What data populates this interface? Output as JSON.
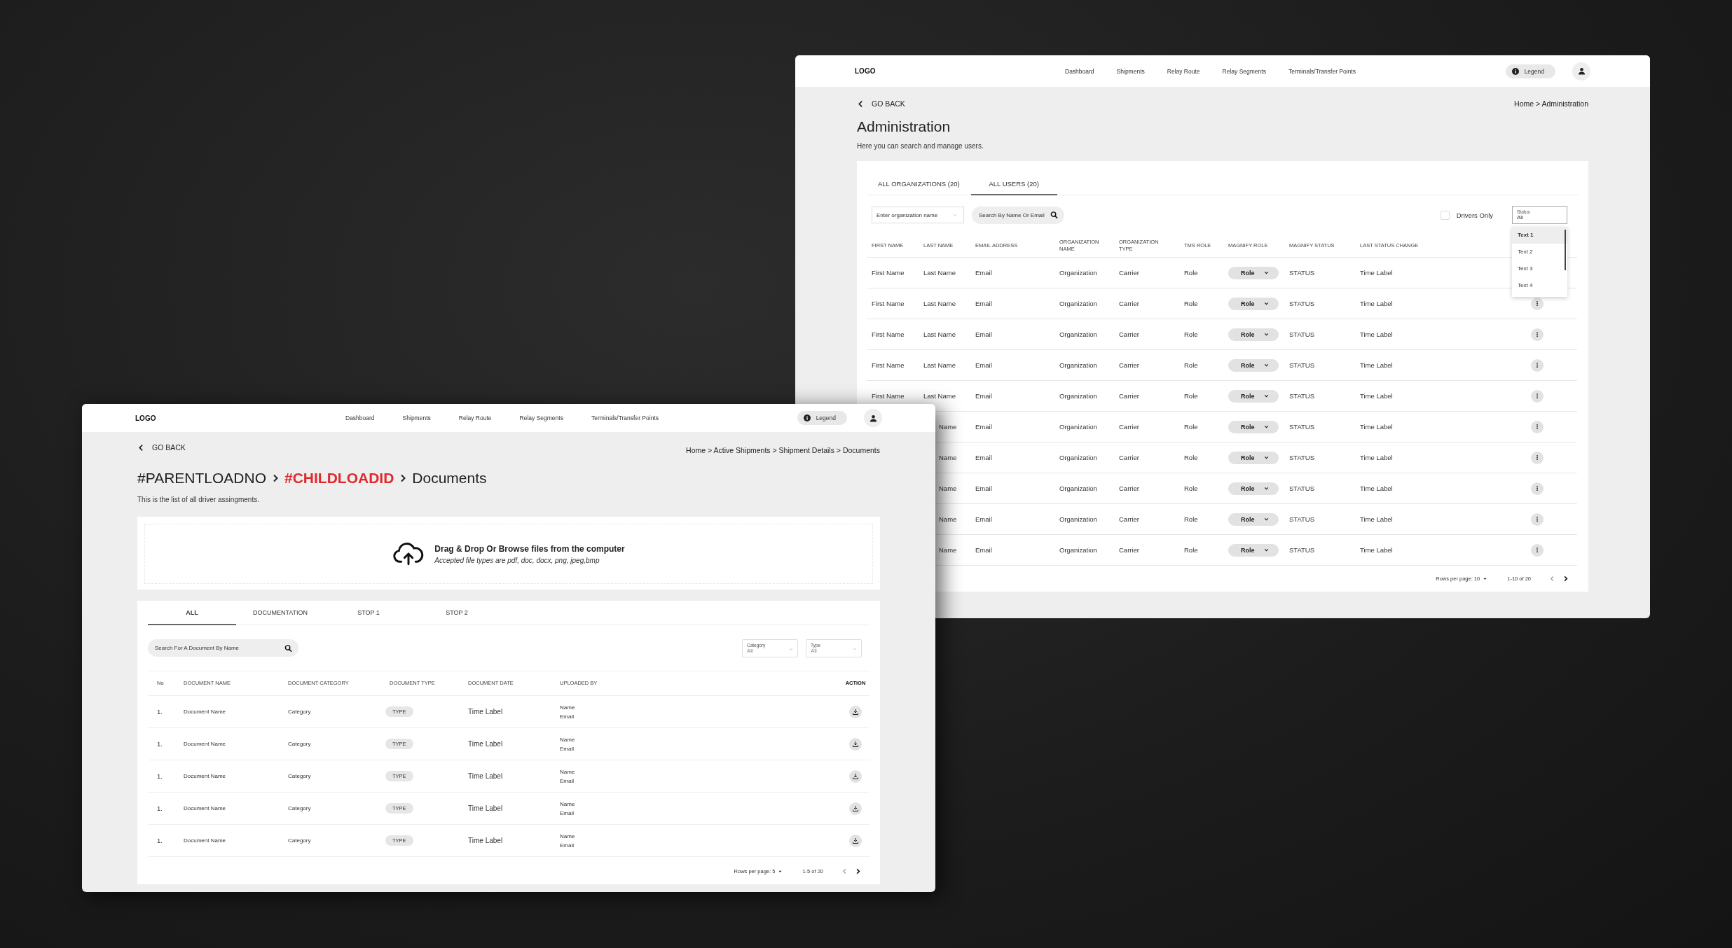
{
  "admin_window": {
    "nav": {
      "logo": "LOGO",
      "items": [
        "Dashboard",
        "Shipments",
        "Relay Route",
        "Relay Segments",
        "Terminals/Transfer Points"
      ],
      "legend": "Legend"
    },
    "go_back": "GO BACK",
    "breadcrumb": "Home > Administration",
    "title": "Administration",
    "subtitle": "Here you can search and manage users.",
    "tabs": [
      {
        "label": "ALL ORGANIZATIONS (20)",
        "selected": false
      },
      {
        "label": "ALL USERS (20)",
        "selected": true
      }
    ],
    "organization_field": {
      "placeholder": "Enter organization name"
    },
    "search": {
      "placeholder": "Search By Name Or Email"
    },
    "drivers_only": {
      "label": "Drivers Only",
      "checked": false
    },
    "status_select": {
      "label": "Status",
      "value": "All",
      "expanded": true,
      "options": [
        {
          "label": "Text 1",
          "selected": true
        },
        {
          "label": "Text 2",
          "selected": false
        },
        {
          "label": "Text 3",
          "selected": false
        },
        {
          "label": "Text 4",
          "selected": false
        }
      ]
    },
    "table": {
      "columns": [
        "FIRST NAME",
        "LAST NAME",
        "EMAIL ADDRESS",
        "ORGANIZATION NAME",
        "ORGANIZATION TYPE",
        "TMS ROLE",
        "MAGNIFY ROLE",
        "MAGNIFY STATUS",
        "LAST STATUS CHANGE"
      ],
      "rows": [
        {
          "first_name": "First Name",
          "last_name": "Last Name",
          "email": "Email",
          "organization": "Organization",
          "organization_type": "Carrier",
          "tms_role": "Role",
          "magnify_role": "Role",
          "magnify_status": "STATUS",
          "last_status_change": "Time Label"
        },
        {
          "first_name": "First Name",
          "last_name": "Last Name",
          "email": "Email",
          "organization": "Organization",
          "organization_type": "Carrier",
          "tms_role": "Role",
          "magnify_role": "Role",
          "magnify_status": "STATUS",
          "last_status_change": "Time Label"
        },
        {
          "first_name": "First Name",
          "last_name": "Last Name",
          "email": "Email",
          "organization": "Organization",
          "organization_type": "Carrier",
          "tms_role": "Role",
          "magnify_role": "Role",
          "magnify_status": "STATUS",
          "last_status_change": "Time Label"
        },
        {
          "first_name": "First Name",
          "last_name": "Last Name",
          "email": "Email",
          "organization": "Organization",
          "organization_type": "Carrier",
          "tms_role": "Role",
          "magnify_role": "Role",
          "magnify_status": "STATUS",
          "last_status_change": "Time Label"
        },
        {
          "first_name": "First Name",
          "last_name": "Last Name",
          "email": "Email",
          "organization": "Organization",
          "organization_type": "Carrier",
          "tms_role": "Role",
          "magnify_role": "Role",
          "magnify_status": "STATUS",
          "last_status_change": "Time Label"
        },
        {
          "last_name": "Name",
          "email": "Email",
          "organization": "Organization",
          "organization_type": "Carrier",
          "tms_role": "Role",
          "magnify_role": "Role",
          "magnify_status": "STATUS",
          "last_status_change": "Time Label"
        },
        {
          "last_name": "Name",
          "email": "Email",
          "organization": "Organization",
          "organization_type": "Carrier",
          "tms_role": "Role",
          "magnify_role": "Role",
          "magnify_status": "STATUS",
          "last_status_change": "Time Label"
        },
        {
          "last_name": "Name",
          "email": "Email",
          "organization": "Organization",
          "organization_type": "Carrier",
          "tms_role": "Role",
          "magnify_role": "Role",
          "magnify_status": "STATUS",
          "last_status_change": "Time Label"
        },
        {
          "last_name": "Name",
          "email": "Email",
          "organization": "Organization",
          "organization_type": "Carrier",
          "tms_role": "Role",
          "magnify_role": "Role",
          "magnify_status": "STATUS",
          "last_status_change": "Time Label"
        },
        {
          "last_name": "Name",
          "email": "Email",
          "organization": "Organization",
          "organization_type": "Carrier",
          "tms_role": "Role",
          "magnify_role": "Role",
          "magnify_status": "STATUS",
          "last_status_change": "Time Label"
        }
      ]
    },
    "pagination": {
      "rows_per_page": "Rows per page: 10",
      "range": "1-10 of 20",
      "previous_disabled": true
    }
  },
  "documents_window": {
    "nav": {
      "logo": "LOGO",
      "items": [
        "Dashboard",
        "Shipments",
        "Relay Route",
        "Relay Segments",
        "Terminals/Transfer Points"
      ],
      "legend": "Legend"
    },
    "go_back": "GO BACK",
    "breadcrumb": "Home > Active Shipments > Shipment Details > Documents",
    "title_parts": [
      {
        "text": "#PARENTLOADNO",
        "highlight": false
      },
      {
        "text": "#CHILDLOADID",
        "highlight": true
      },
      {
        "text": "Documents",
        "highlight": false
      }
    ],
    "subtitle": "This is the list of all driver assingments.",
    "upload": {
      "title": "Drag & Drop Or Browse files from the computer",
      "hint": "Accepted file types are pdf, doc, docx, png, jpeg,bmp"
    },
    "tabs": [
      {
        "label": "ALL",
        "selected": true
      },
      {
        "label": "DOCUMENTATION",
        "selected": false
      },
      {
        "label": "STOP 1",
        "selected": false
      },
      {
        "label": "STOP 2",
        "selected": false
      }
    ],
    "search": {
      "placeholder": "Search For A Document By Name"
    },
    "category_select": {
      "label": "Category",
      "value": "All"
    },
    "type_select": {
      "label": "Type",
      "value": "All"
    },
    "table": {
      "columns": [
        "No",
        "DOCUMENT NAME",
        "DOCUMENT CATEGORY",
        "DOCUMENT TYPE",
        "DOCUMENT DATE",
        "UPLOADED BY",
        "ACTION"
      ],
      "rows": [
        {
          "no": "1.",
          "name": "Document Name",
          "category": "Category",
          "type": "TYPE",
          "date": "Time Label",
          "uploader_name": "Name",
          "uploader_email": "Email"
        },
        {
          "no": "1.",
          "name": "Document Name",
          "category": "Category",
          "type": "TYPE",
          "date": "Time Label",
          "uploader_name": "Name",
          "uploader_email": "Email"
        },
        {
          "no": "1.",
          "name": "Document Name",
          "category": "Category",
          "type": "TYPE",
          "date": "Time Label",
          "uploader_name": "Name",
          "uploader_email": "Email"
        },
        {
          "no": "1.",
          "name": "Document Name",
          "category": "Category",
          "type": "TYPE",
          "date": "Time Label",
          "uploader_name": "Name",
          "uploader_email": "Email"
        },
        {
          "no": "1.",
          "name": "Document Name",
          "category": "Category",
          "type": "TYPE",
          "date": "Time Label",
          "uploader_name": "Name",
          "uploader_email": "Email"
        }
      ]
    },
    "pagination": {
      "rows_per_page": "Rows per page: 5",
      "range": "1-5 of 20",
      "previous_disabled": true
    }
  }
}
